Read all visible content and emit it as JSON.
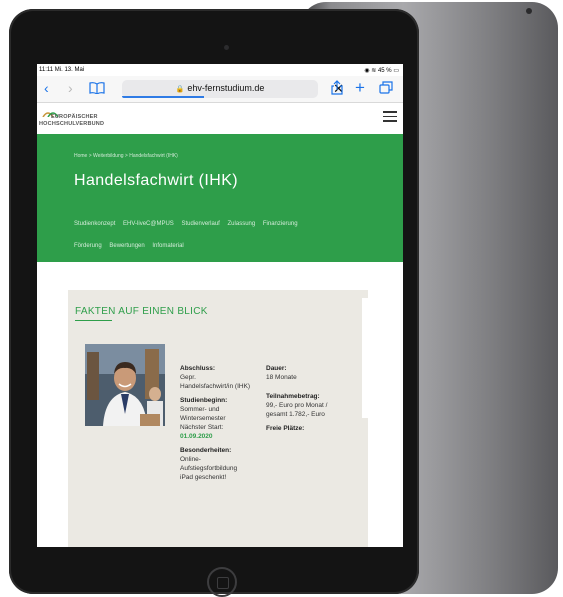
{
  "status_bar": {
    "time": "11:11  Mi. 13. Mai",
    "battery": "45 %"
  },
  "browser": {
    "url": "ehv-fernstudium.de",
    "loading_progress": 0.42,
    "icons": [
      "back-icon",
      "forward-icon",
      "bookmarks-icon",
      "lock-icon",
      "stop-icon",
      "share-icon",
      "new-tab-icon",
      "tabs-icon"
    ]
  },
  "site": {
    "logo_line1": "EUROPÄISCHER",
    "logo_line2": "HOCHSCHULVERBUND"
  },
  "hero": {
    "breadcrumb": "Home  >  Weiterbildung  >  Handelsfachwirt (IHK)",
    "title": "Handelsfachwirt (IHK)",
    "tabs": [
      "Studienkonzept",
      "EHV-liveC@MPUS",
      "Studienverlauf",
      "Zulassung",
      "Finanzierung",
      "Förderung",
      "Bewertungen",
      "Infomaterial"
    ]
  },
  "facts": {
    "title": "FAKTEN AUF EINEN BLICK",
    "abschluss_label": "Abschluss:",
    "abschluss_value1": "Gepr.",
    "abschluss_value2": "Handelsfachwirt/in (IHK)",
    "studienbeginn_label": "Studienbeginn:",
    "studienbeginn_value1": "Sommer- und",
    "studienbeginn_value2": "Wintersemester",
    "naechster_start_label": "Nächster Start:",
    "naechster_start_value": "01.09.2020",
    "besonderheiten_label": "Besonderheiten:",
    "besonderheiten_value1": "Online-",
    "besonderheiten_value2": "Aufstiegsfortbildung",
    "besonderheiten_value3": "iPad geschenkt!",
    "dauer_label": "Dauer:",
    "dauer_value": "18 Monate",
    "teilnahme_label": "Teilnahmebetrag:",
    "teilnahme_value1": "99,- Euro pro Monat /",
    "teilnahme_value2": "gesamt 1.782,- Euro",
    "plaetze_label": "Freie Plätze:"
  },
  "colors": {
    "brand_green": "#2e9e4a",
    "box_bg": "#ebe9e3",
    "link_blue": "#1a73e8"
  }
}
